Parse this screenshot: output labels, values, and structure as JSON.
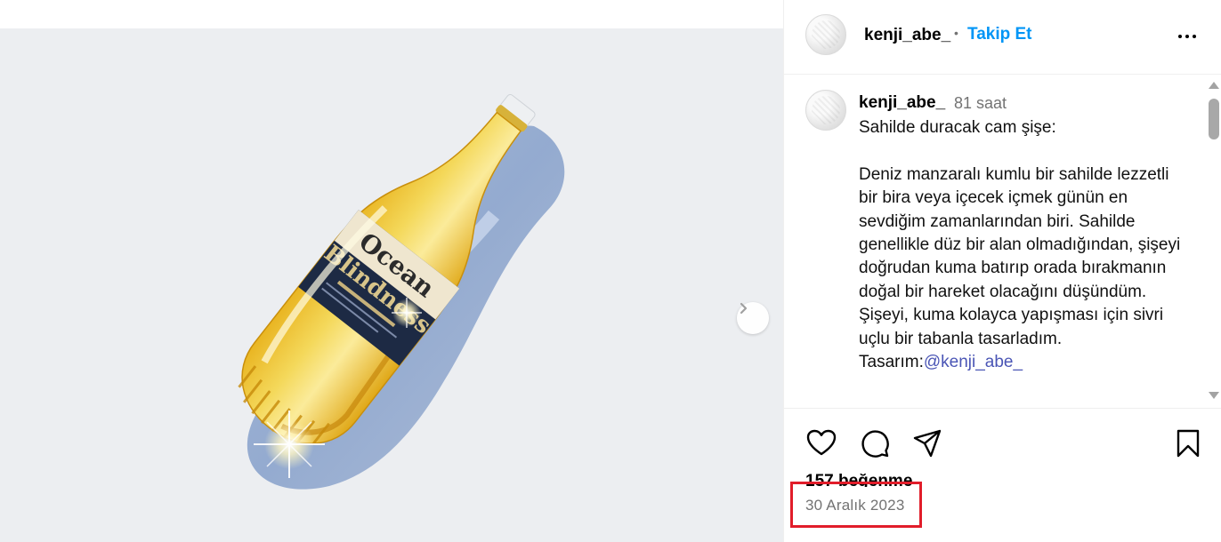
{
  "media": {
    "carousel_dots": 3,
    "active_dot": 0
  },
  "header": {
    "username": "kenji_abe_",
    "separator": "•",
    "follow_label": "Takip Et"
  },
  "post": {
    "username": "kenji_abe_",
    "time": "81 saat",
    "caption_pre": "Sahilde duracak cam şişe:\n\nDeniz manzaralı kumlu bir sahilde lezzetli bir bira veya içecek içmek günün en sevdiğim zamanlarından biri. Sahilde genellikle düz bir alan olmadığından, şişeyi doğrudan kuma batırıp orada bırakmanın doğal bir hareket olacağını düşündüm. Şişeyi, kuma kolayca yapışması için sivri uçlu bir tabanla tasarladım.\nTasarım:",
    "caption_mention": "@kenji_abe_"
  },
  "actions": {
    "like_icon": "heart-icon",
    "comment_icon": "comment-icon",
    "share_icon": "share-icon",
    "save_icon": "bookmark-icon",
    "likes": "157 beğenme",
    "date": "30 Aralık 2023"
  },
  "colors": {
    "follow": "#0095f6",
    "mention": "#4a55b5",
    "highlight": "#e11d2a",
    "media_bg": "#eceef1"
  }
}
